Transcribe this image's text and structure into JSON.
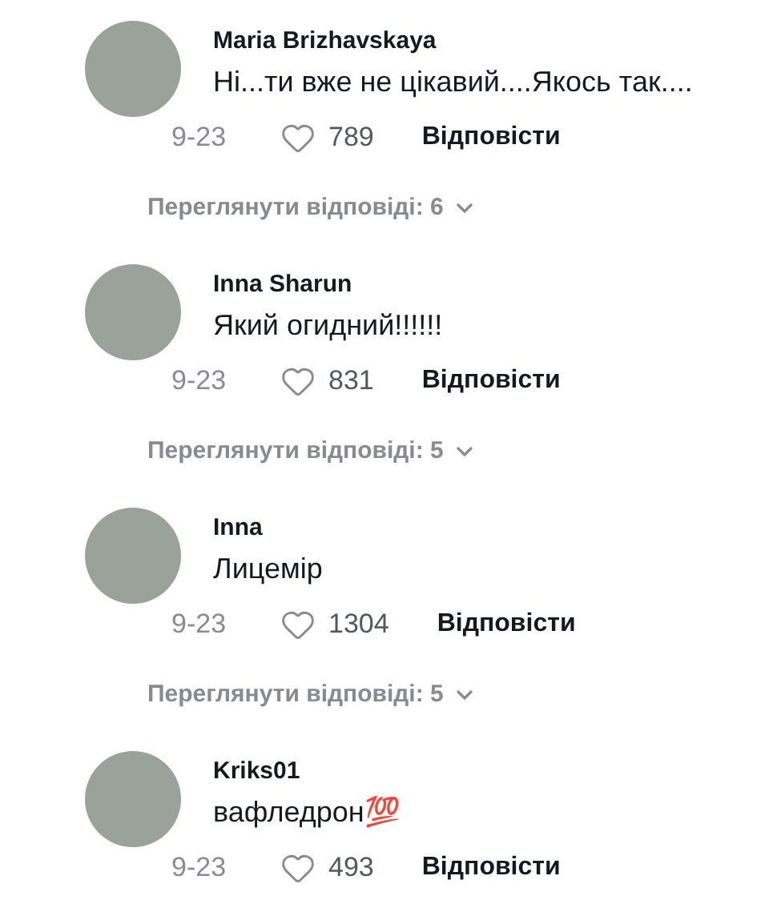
{
  "comments": [
    {
      "username": "Maria Brizhavskaya",
      "text": "Ні...ти вже не цікавий....Якось так....",
      "date": "9-23",
      "likes": "789",
      "reply_label": "Відповісти",
      "view_replies": "Переглянути відповіді: 6"
    },
    {
      "username": "Inna Sharun",
      "text": "Який огидний!!!!!!",
      "date": "9-23",
      "likes": "831",
      "reply_label": "Відповісти",
      "view_replies": "Переглянути відповіді: 5"
    },
    {
      "username": "Inna",
      "text": "Лицемір",
      "date": "9-23",
      "likes": "1304",
      "reply_label": "Відповісти",
      "view_replies": "Переглянути відповіді: 5"
    },
    {
      "username": "Kriks01",
      "text": "вафледрон💯",
      "date": "9-23",
      "likes": "493",
      "reply_label": "Відповісти"
    }
  ]
}
